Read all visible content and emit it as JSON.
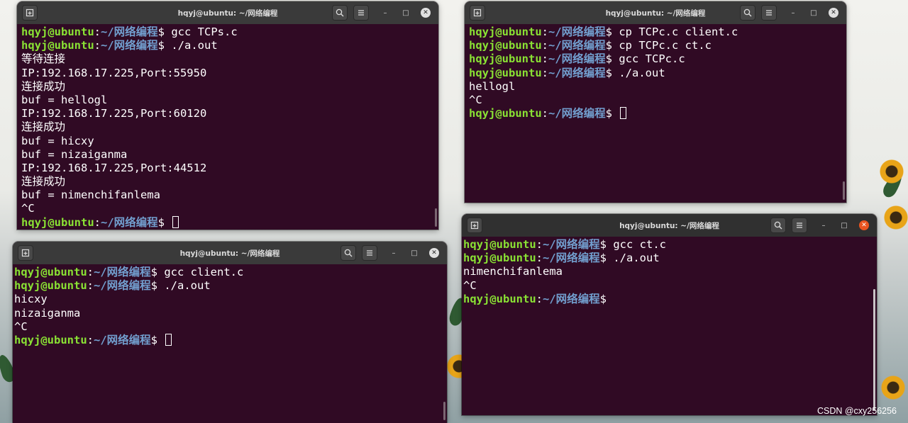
{
  "windows": [
    {
      "id": "w1",
      "title": "hqyj@ubuntu: ~/网络编程",
      "active": false,
      "lines": [
        {
          "user": "hqyj@ubuntu",
          "path": "~/网络编程",
          "cmd": "gcc TCPs.c"
        },
        {
          "user": "hqyj@ubuntu",
          "path": "~/网络编程",
          "cmd": "./a.out"
        },
        {
          "text": "等待连接"
        },
        {
          "text": "IP:192.168.17.225,Port:55950"
        },
        {
          "text": "连接成功"
        },
        {
          "text": "buf = hellogl"
        },
        {
          "text": "IP:192.168.17.225,Port:60120"
        },
        {
          "text": "连接成功"
        },
        {
          "text": "buf = hicxy"
        },
        {
          "text": "buf = nizaiganma"
        },
        {
          "text": "IP:192.168.17.225,Port:44512"
        },
        {
          "text": "连接成功"
        },
        {
          "text": "buf = nimenchifanlema"
        },
        {
          "text": "^C"
        },
        {
          "user": "hqyj@ubuntu",
          "path": "~/网络编程",
          "cmd": "",
          "cursor": true
        }
      ]
    },
    {
      "id": "w2",
      "title": "hqyj@ubuntu: ~/网络编程",
      "active": false,
      "lines": [
        {
          "user": "hqyj@ubuntu",
          "path": "~/网络编程",
          "cmd": "cp TCPc.c client.c"
        },
        {
          "user": "hqyj@ubuntu",
          "path": "~/网络编程",
          "cmd": "cp TCPc.c ct.c"
        },
        {
          "user": "hqyj@ubuntu",
          "path": "~/网络编程",
          "cmd": "gcc TCPc.c"
        },
        {
          "user": "hqyj@ubuntu",
          "path": "~/网络编程",
          "cmd": "./a.out"
        },
        {
          "text": "hellogl"
        },
        {
          "text": "^C"
        },
        {
          "user": "hqyj@ubuntu",
          "path": "~/网络编程",
          "cmd": "",
          "cursor": true
        }
      ]
    },
    {
      "id": "w3",
      "title": "hqyj@ubuntu: ~/网络编程",
      "active": false,
      "lines": [
        {
          "user": "hqyj@ubuntu",
          "path": "~/网络编程",
          "cmd": "gcc client.c"
        },
        {
          "user": "hqyj@ubuntu",
          "path": "~/网络编程",
          "cmd": "./a.out"
        },
        {
          "text": "hicxy"
        },
        {
          "text": "nizaiganma"
        },
        {
          "text": "^C"
        },
        {
          "user": "hqyj@ubuntu",
          "path": "~/网络编程",
          "cmd": "",
          "cursor": true
        }
      ]
    },
    {
      "id": "w4",
      "title": "hqyj@ubuntu: ~/网络编程",
      "active": true,
      "lines": [
        {
          "user": "hqyj@ubuntu",
          "path": "~/网络编程",
          "cmd": "gcc ct.c"
        },
        {
          "user": "hqyj@ubuntu",
          "path": "~/网络编程",
          "cmd": "./a.out"
        },
        {
          "text": "nimenchifanlema"
        },
        {
          "text": "^C"
        },
        {
          "user": "hqyj@ubuntu",
          "path": "~/网络编程",
          "cmd": "",
          "cursor": false
        }
      ]
    }
  ],
  "prompt_symbol": "$",
  "colors": {
    "terminal_bg": "#300a24",
    "user_green": "#8ae234",
    "path_blue": "#729fcf",
    "close_active": "#e95420"
  },
  "icons": {
    "new_tab": "new-tab-icon",
    "search": "search-icon",
    "menu": "hamburger-menu-icon",
    "minimize": "minimize-icon",
    "maximize": "maximize-icon",
    "close": "close-icon"
  },
  "watermark": "CSDN @cxy256256"
}
